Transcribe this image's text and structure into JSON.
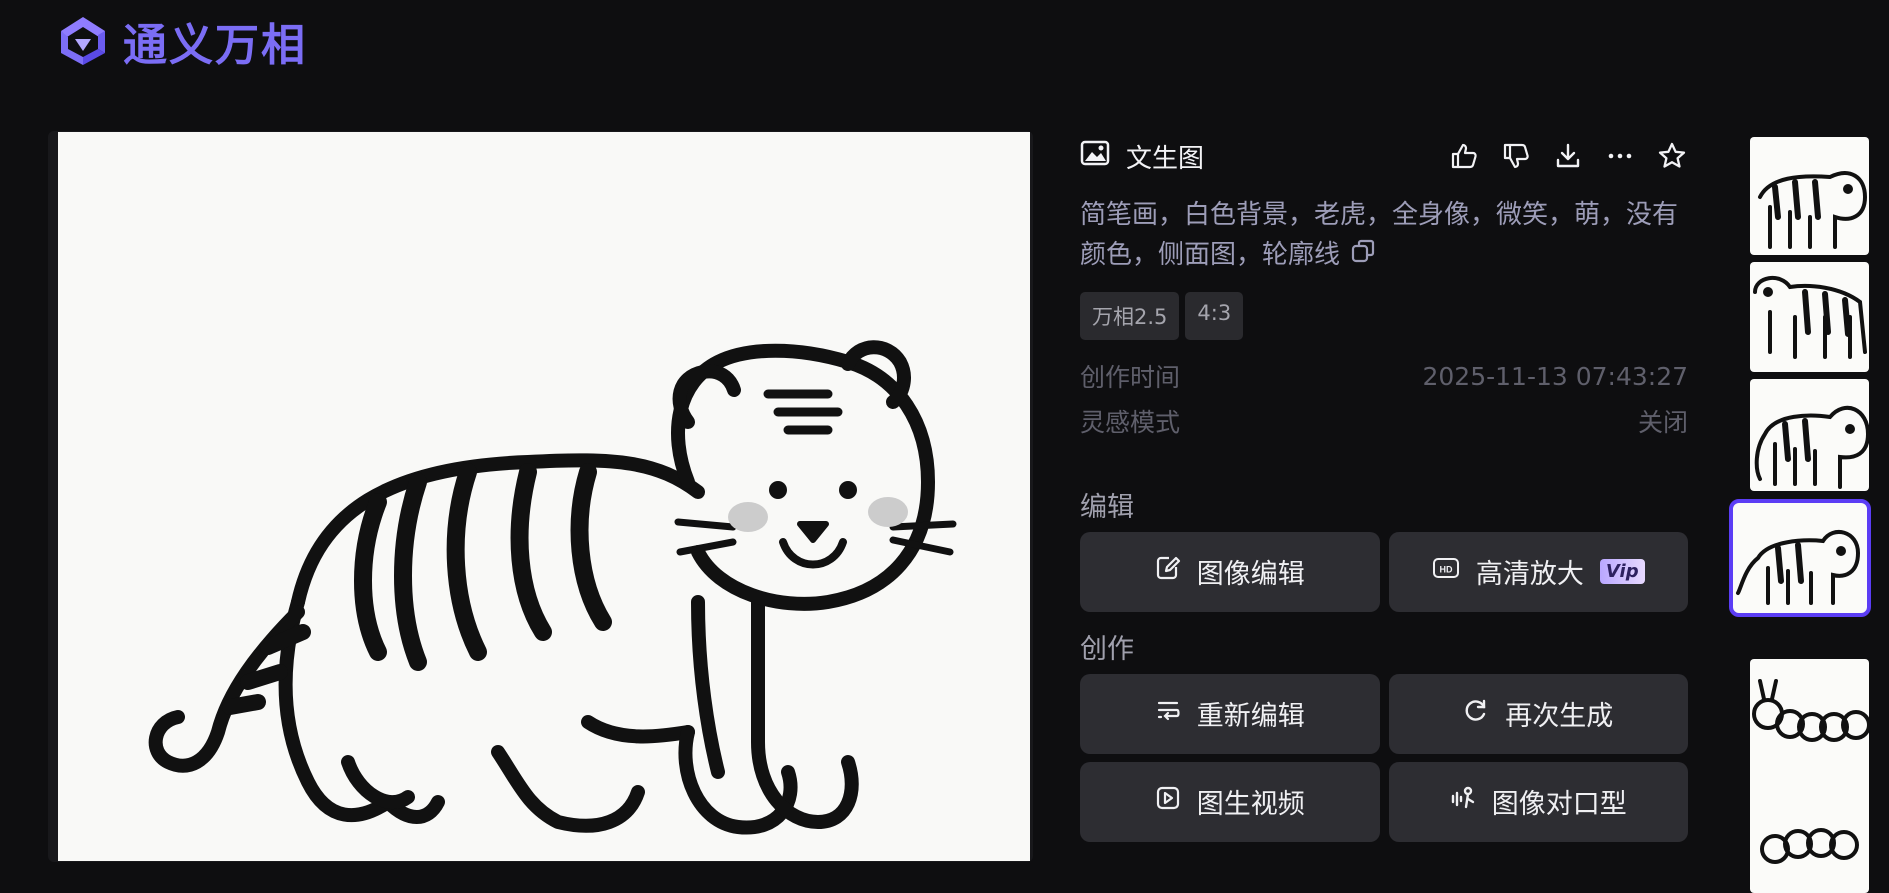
{
  "brand": {
    "name": "通义万相"
  },
  "panel": {
    "type_label": "文生图",
    "prompt": "简笔画，白色背景，老虎，全身像，微笑，萌，没有颜色，侧面图，轮廓线",
    "tags": [
      "万相2.5",
      "4:3"
    ],
    "meta": [
      {
        "label": "创作时间",
        "value": "2025-11-13 07:43:27"
      },
      {
        "label": "灵感模式",
        "value": "关闭"
      }
    ],
    "sections": {
      "edit": "编辑",
      "create": "创作"
    },
    "buttons": {
      "image_edit": "图像编辑",
      "hd_upscale": "高清放大",
      "vip_badge": "Vip",
      "re_edit": "重新编辑",
      "regenerate": "再次生成",
      "image_to_video": "图生视频",
      "lip_sync": "图像对口型"
    }
  },
  "icons": {
    "header": [
      "image-icon",
      "thumbs-up-icon",
      "thumbs-down-icon",
      "download-icon",
      "more-icon",
      "star-icon"
    ],
    "buttons": [
      "edit-icon",
      "hd-icon",
      "re-edit-icon",
      "refresh-icon",
      "video-icon",
      "lip-sync-icon"
    ]
  },
  "colors": {
    "brand": "#7b6df5",
    "selected_border": "#5b3df5",
    "button_bg": "#2d2d32"
  }
}
